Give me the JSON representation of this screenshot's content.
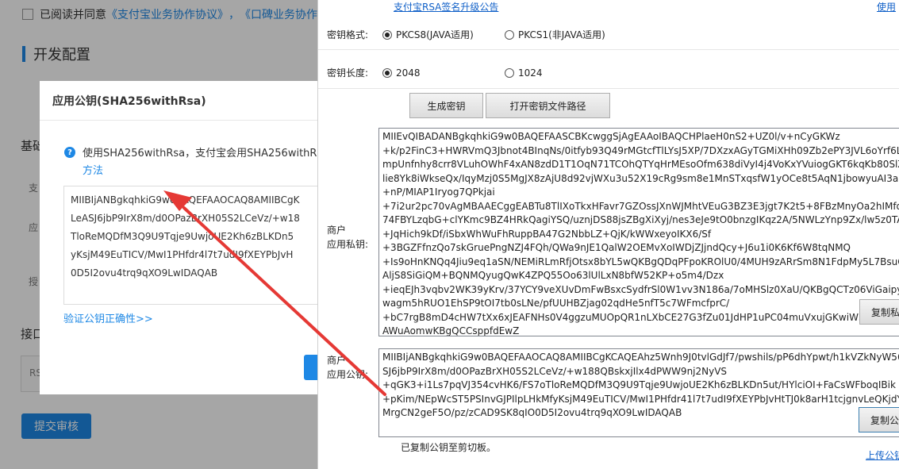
{
  "background": {
    "agree_prefix": "已阅读并同意",
    "agree_link1": "《支付宝业务协作协议》",
    "agree_sep": "，",
    "agree_link2": "《口碑业务协作协议",
    "section_title": "开发配置",
    "basic_label": "基础",
    "side_labels": [
      "支",
      "应",
      "授"
    ],
    "interface_label": "接口",
    "rs_label": "RS",
    "submit_label": "提交审核"
  },
  "modal": {
    "title": "应用公钥(SHA256withRsa)",
    "info_icon": "?",
    "info_text": "使用SHA256withRsa，支付宝会用SHA256withR",
    "info_method": "方法",
    "key_lines": [
      "MIIBIjANBgkqhkiG9w0BAQEFAAOCAQ8AMIIBCgK",
      "LeASJ6jbP9IrX8m/d0OPazBrXH05S2LCeVz/+w18",
      "TloReMQDfM3Q9U9Tqje9UwjoUE2Kh6zBLKDn5",
      "yKsjM49EuTICV/MwI1PHfdr4l7t7udI9fXEYPbJvH",
      "0D5I2ovu4trq9qXO9LwIDAQAB"
    ],
    "verify_link": "验证公钥正确性>>"
  },
  "tool": {
    "announce_link": "支付宝RSA签名升级公告",
    "use_link": "使用",
    "format_label": "密钥格式:",
    "format_options": [
      "PKCS8(JAVA适用)",
      "PKCS1(非JAVA适用)"
    ],
    "format_selected": "PKCS8(JAVA适用)",
    "length_label": "密钥长度:",
    "length_options": [
      "2048",
      "1024"
    ],
    "length_selected": "2048",
    "generate_button": "生成密钥",
    "open_path_button": "打开密钥文件路径",
    "private_label_1": "商户",
    "private_label_2": "应用私钥:",
    "private_key_lines": [
      "MIIEvQIBADANBgkqhkiG9w0BAQEFAASCBKcwggSjAgEAAoIBAQCHPlaeH0nS2+UZ0l/v+nCyGKWz",
      "+k/p2FinC3+HWRVmQ3Jbnot4BInqNs/0itfyb93Q49rMGtcfTlLYsJ5XP/7DXzxAGyTGMiXHh09Zb2ePY3JVL6oYrf6LUu",
      "mpUnfnhy8crr8VLuhOWhF4xAN8zdD1T1OqN71TCOhQTYqHrMEsoOfm638diVyI4j4VoKxYVuiogGKT6kqKb80SlZxA",
      "lie8Yk8iWkseQx/IqyMzj0S5MgJX8zAjU8d92vjWXu3u52X19cRg9sm8e1MnSTxqsfW1yOCe8t5AqN1jbowyuAI3aB4X",
      "+nP/MIAP1Iryog7QPkjai",
      "+7i2ur2pc70vAgMBAAECggEABTu8TlIXoTkxHFavr7GZOssJXnWJMhtVEuG3BZ3E3jgt7K2t5+8FBzMnyOa2hIMfqj2n",
      "74FBYLzqbG+clYKmc9BZ4HRkQagiYSQ/uznjDS88jsZBgXiXyj/nes3eJe9tO0bnzgIKqz2A/5NWLzYnp9Zx/lw5z0TA",
      "+JqHich9kDf/iSbxWhWuFhRuppBA47G2NbbLZ+QjK/kWWxeyoIKX6/Sf",
      "+3BGZFfnzQo7skGruePngNZJ4FQh/QWa9nJE1QalW2OEMvXoIWDjZJjndQcy+J6u1i0K6Kf6W8tqNMQ",
      "+Is9oHnKNQq4Jiu9eq1aSN/NEMiRLmRfjOtsx8bYL5wQKBgQDqPFpoKROlU0/4MUH9zARrSm8N1FdpMy5L7BsuG",
      "AljS8SiGiQM+BQNMQyugQwK4ZPQ55Oo63lUlLxN8bfW52KP+o5m4/Dzx",
      "+ieqEJh3vqbv2WK39yKrv/37YCY9veXUvDmFwBsxcSydfrSl0W1vv3N186a/7oMHSlz0XaU/QKBgQCTz06ViGaipyQtv",
      "wagm5hRUO1EhSP9tOI7tb0sLNe/pfUUHBZjag02qdHe5nfT5c7WFmcfprC/",
      "+bC7rgB8mD4cHW7tXx6xJEAFNHs0V4ggzuMUOpQR1nLXbCE27G3fZu01JdHP1uPC04muVxujGKwiW3JD",
      "AWuAomwKBgQCCsppfdEwZ"
    ],
    "copy_private_button": "复制私钥",
    "public_label_1": "商户",
    "public_label_2": "应用公钥:",
    "public_key_lines": [
      "MIIBIjANBgkqhkiG9w0BAQEFAAOCAQ8AMIIBCgKCAQEAhz5Wnh9J0tvlGdJf7/pwshils/pP6dhYpwt/h1kVZkNyW56l",
      "SJ6jbP9IrX8m/d0OPazBrXH05S2LCeVz/+w188QBskxjIlx4dPWW9nj2NyVS",
      "+qGK3+i1Ls7pqVJ354cvHK6/FS7oTloReMQDfM3Q9U9Tqje9UwjoUE2Kh6zBLKDn5ut/HYlciOI+FaCsWFboqIBik",
      "+pKim/NEpWcST5PSInvGJPIlpLHkMfyKsjM49EuTICV/MwI1PHfdr41l7t7udI9fXEYPbJvHtTJ0k8arH1tcjgnvLeQKjdY2(",
      "MrgCN2geF5O/pz/zCAD9SK8qIO0D5I2ovu4trq9qXO9LwIDAQAB"
    ],
    "copy_public_button": "复制公钥",
    "status_text": "已复制公钥至剪切板。",
    "upload_link": "上传公钥"
  }
}
